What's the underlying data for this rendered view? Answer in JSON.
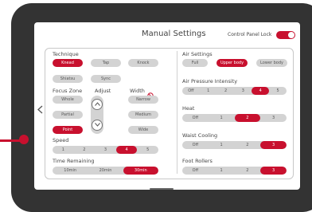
{
  "header": {
    "title": "Manual Settings",
    "control_panel_lock_label": "Control Panel Lock",
    "control_panel_lock_on": true
  },
  "colors": {
    "accent": "#c8102e",
    "pill_off": "#d3d3d3",
    "bezel": "#333333"
  },
  "left": {
    "technique": {
      "label": "Technique",
      "options": [
        "Knead",
        "Tap",
        "Knock",
        "Shiatsu",
        "Sync"
      ],
      "selected": "Knead"
    },
    "focus_zone": {
      "label": "Focus Zone",
      "options": [
        "Whole",
        "Partial",
        "Point"
      ],
      "selected": "Point"
    },
    "adjust": {
      "label": "Adjust",
      "up_icon": "chevron-up-icon",
      "down_icon": "chevron-down-icon"
    },
    "width": {
      "label": "Width",
      "icon": "prohibited-icon",
      "options": [
        "Narrow",
        "Medium",
        "Wide"
      ]
    },
    "speed": {
      "label": "Speed",
      "options": [
        "1",
        "2",
        "3",
        "4",
        "5"
      ],
      "selected": "4"
    },
    "time_remaining": {
      "label": "Time Remaining",
      "options": [
        "10min",
        "20min",
        "30min"
      ],
      "selected": "30min"
    }
  },
  "right": {
    "air_settings": {
      "label": "Air Settings",
      "options": [
        "Full",
        "Upper body",
        "Lower body"
      ],
      "selected": "Upper body"
    },
    "air_pressure": {
      "label": "Air Pressure Intensity",
      "options": [
        "Off",
        "1",
        "2",
        "3",
        "4",
        "5"
      ],
      "selected": "4"
    },
    "heat": {
      "label": "Heat",
      "options": [
        "Off",
        "1",
        "2",
        "3"
      ],
      "selected": "2"
    },
    "waist_cooling": {
      "label": "Waist Cooling",
      "options": [
        "Off",
        "1",
        "2",
        "3"
      ],
      "selected": "3"
    },
    "foot_rollers": {
      "label": "Foot Rollers",
      "options": [
        "Off",
        "1",
        "2",
        "3"
      ],
      "selected": "3"
    }
  },
  "nav": {
    "back_icon": "chevron-left-icon"
  }
}
